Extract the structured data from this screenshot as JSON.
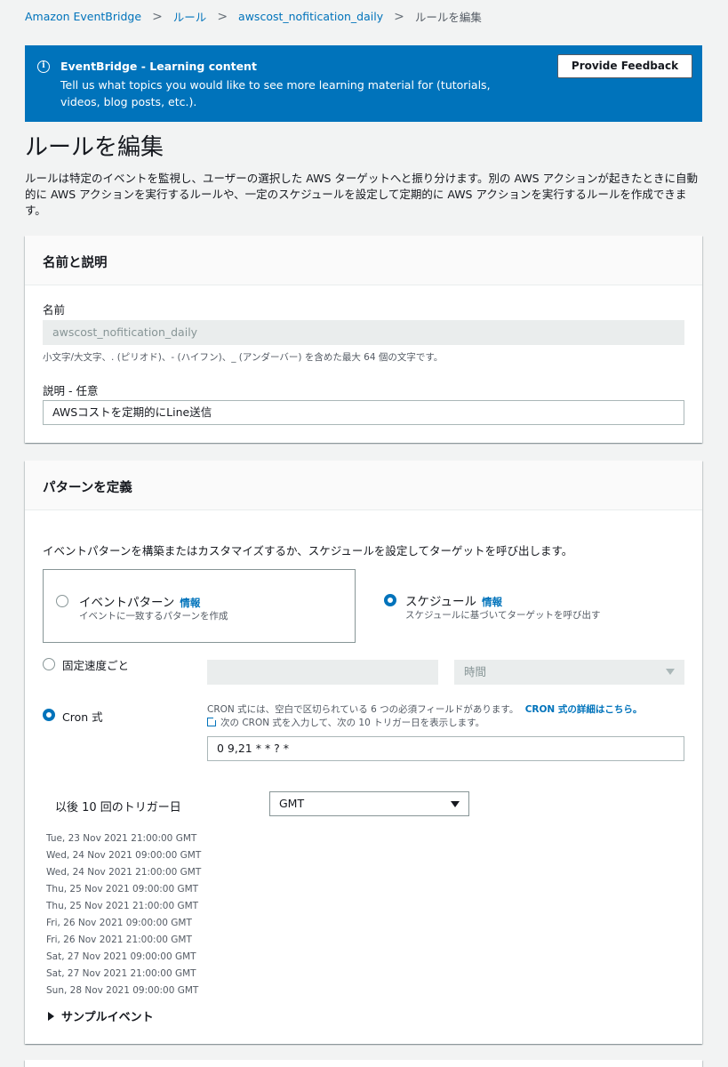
{
  "breadcrumb": {
    "items": [
      "Amazon EventBridge",
      "ルール",
      "awscost_nofitication_daily"
    ],
    "current": "ルールを編集"
  },
  "flash": {
    "title": "EventBridge - Learning content",
    "body": "Tell us what topics you would like to see more learning material for (tutorials, videos, blog posts, etc.).",
    "button": "Provide Feedback",
    "icon": "info-icon",
    "color": "#0073bb"
  },
  "page": {
    "title": "ルールを編集",
    "description": "ルールは特定のイベントを監視し、ユーザーの選択した AWS ターゲットへと振り分けます。別の AWS アクションが起きたときに自動的に AWS アクションを実行するルールや、一定のスケジュールを設定して定期的に AWS アクションを実行するルールを作成できます。"
  },
  "name_section": {
    "title": "名前と説明",
    "name_label": "名前",
    "name_value": "awscost_nofitication_daily",
    "name_hint": "小文字/大文字、. (ピリオド)、- (ハイフン)、_ (アンダーバー) を含めた最大 64 個の文字です。",
    "desc_label": "説明 - 任意",
    "desc_value": "AWSコストを定期的にLine送信"
  },
  "pattern_section": {
    "title": "パターンを定義",
    "intro": "イベントパターンを構築またはカスタマイズするか、スケジュールを設定してターゲットを呼び出します。",
    "event_pattern": {
      "label": "イベントパターン",
      "info": "情報",
      "desc": "イベントに一致するパターンを作成",
      "selected": false
    },
    "schedule": {
      "label": "スケジュール",
      "info": "情報",
      "desc": "スケジュールに基づいてターゲットを呼び出す",
      "selected": true
    },
    "fixed_rate": {
      "label": "固定速度ごと",
      "value": "",
      "unit": "時間",
      "selected": false
    },
    "cron": {
      "label": "Cron 式",
      "help": "CRON 式には、空白で区切られている 6 つの必須フィールドがあります。",
      "help_link": "CRON 式の詳細はこちら。",
      "help2": "次の CRON 式を入力して、次の 10 トリガー日を表示します。",
      "value": "0 9,21 * * ? *",
      "selected": true
    },
    "trigger": {
      "label": "以後 10 回のトリガー日",
      "timezone": "GMT",
      "dates": [
        "Tue, 23 Nov 2021 21:00:00 GMT",
        "Wed, 24 Nov 2021 09:00:00 GMT",
        "Wed, 24 Nov 2021 21:00:00 GMT",
        "Thu, 25 Nov 2021 09:00:00 GMT",
        "Thu, 25 Nov 2021 21:00:00 GMT",
        "Fri, 26 Nov 2021 09:00:00 GMT",
        "Fri, 26 Nov 2021 21:00:00 GMT",
        "Sat, 27 Nov 2021 09:00:00 GMT",
        "Sat, 27 Nov 2021 21:00:00 GMT",
        "Sun, 28 Nov 2021 09:00:00 GMT"
      ]
    },
    "sample_event": "サンプルイベント"
  }
}
